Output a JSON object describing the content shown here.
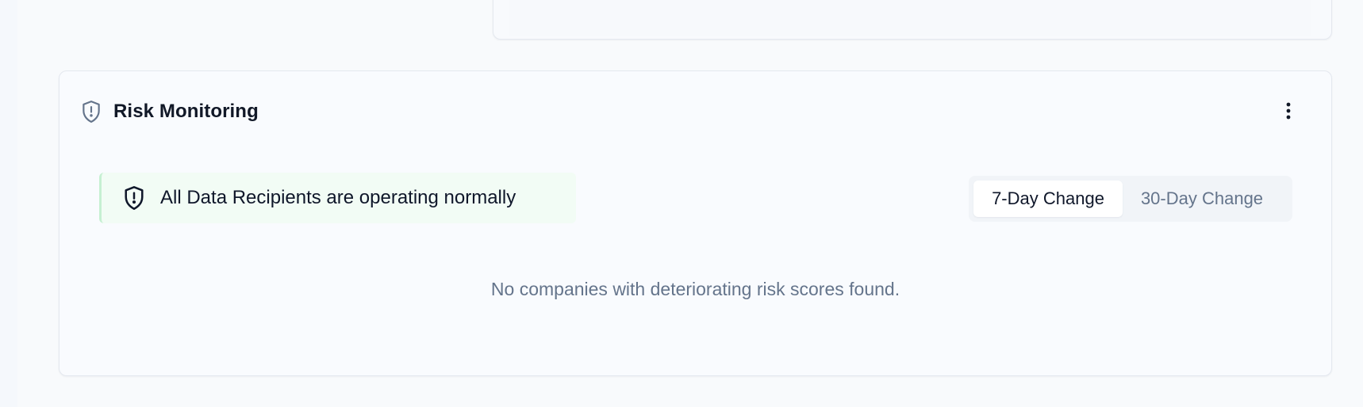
{
  "risk_monitoring": {
    "title": "Risk Monitoring",
    "header_icon": "shield-alert-icon",
    "menu_icon": "more-vertical-icon",
    "status_banner": {
      "text": "All Data Recipients are operating normally",
      "icon": "shield-alert-icon"
    },
    "period_toggle": {
      "options": [
        {
          "label": "7-Day Change",
          "selected": true
        },
        {
          "label": "30-Day Change",
          "selected": false
        }
      ]
    },
    "empty_message": "No companies with deteriorating risk scores found."
  },
  "colors": {
    "background": "#f8fafc",
    "card_border": "#e4e8ef",
    "banner_bg": "#f2fcf5",
    "banner_accent": "#c6f0d2",
    "muted_text": "#64748b",
    "icon_gray": "#64748b"
  }
}
